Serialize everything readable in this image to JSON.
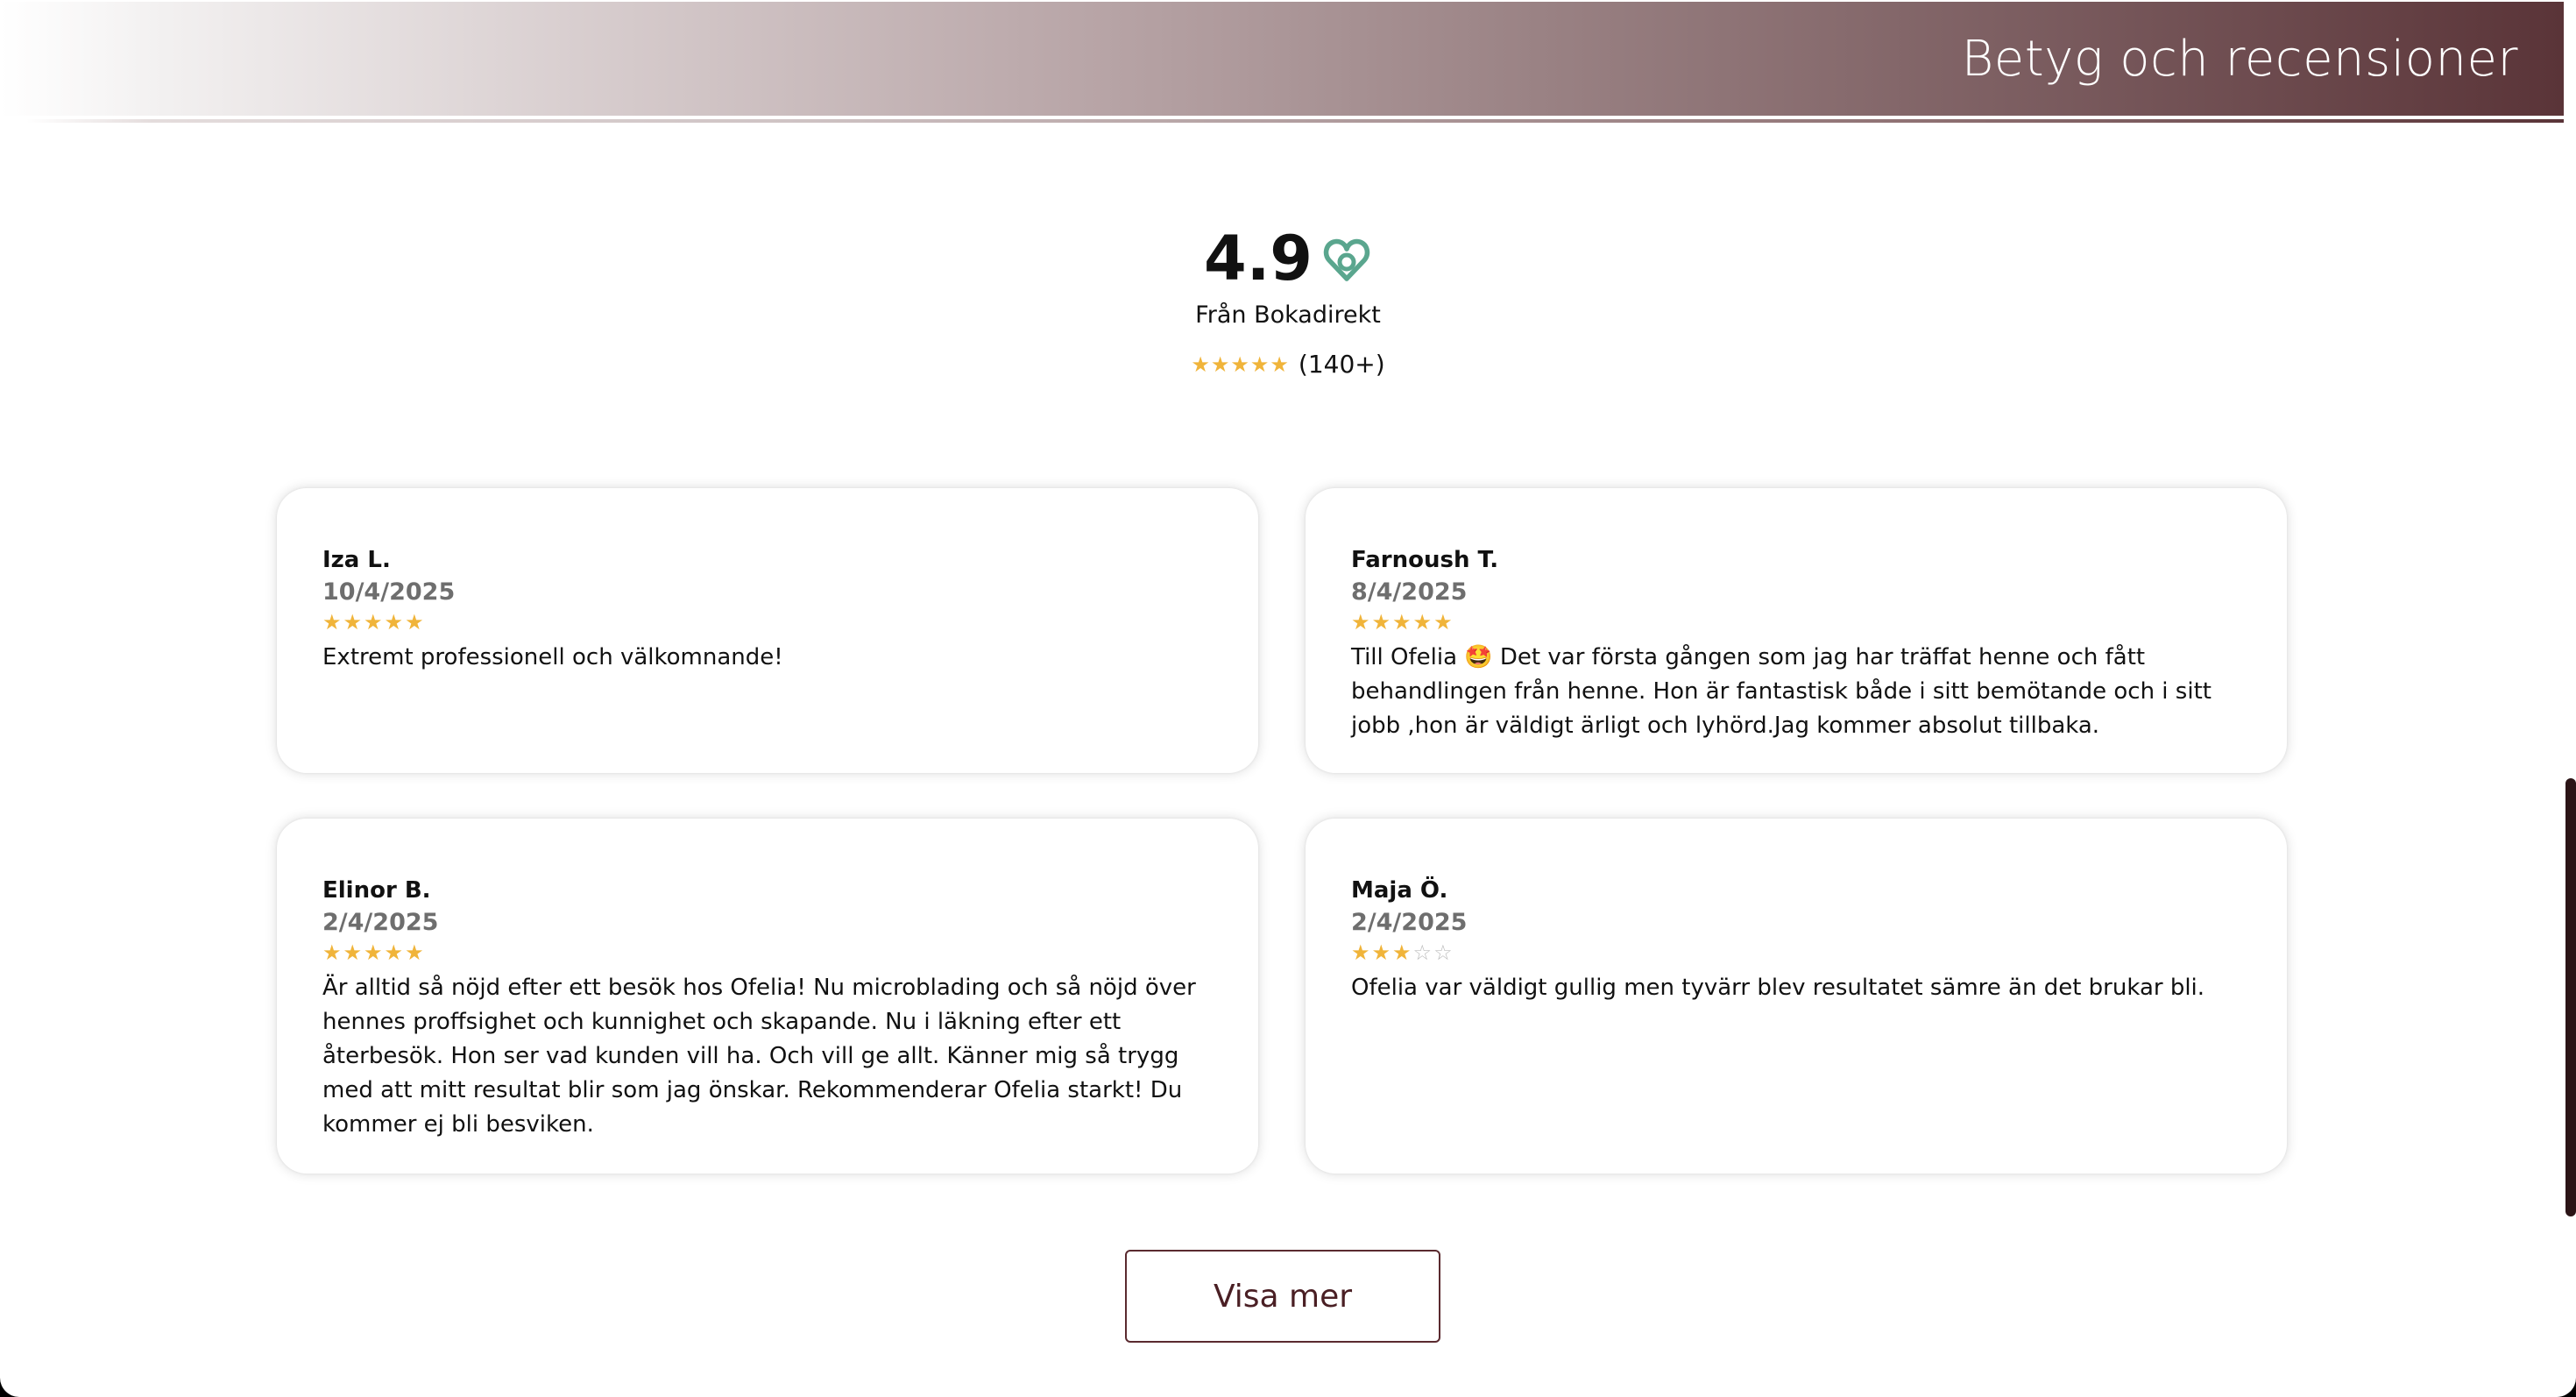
{
  "header": {
    "title": "Betyg och recensioner"
  },
  "summary": {
    "score": "4.9",
    "source": "Från Bokadirekt",
    "stars": "★★★★★",
    "count": "(140+)",
    "logo_icon": "bokadirekt-logo-icon",
    "logo_color": "#5aa68e"
  },
  "reviews": [
    {
      "name": "Iza L.",
      "date": "10/4/2025",
      "rating": 5,
      "stars_filled": "★★★★★",
      "stars_empty": "",
      "text": "Extremt professionell och välkomnande!"
    },
    {
      "name": "Farnoush T.",
      "date": "8/4/2025",
      "rating": 5,
      "stars_filled": "★★★★★",
      "stars_empty": "",
      "text": "Till Ofelia 🤩 Det var första gången som jag har träffat henne och fått behandlingen från henne. Hon är fantastisk både i sitt bemötande och i sitt jobb ,hon är väldigt ärligt och lyhörd.Jag kommer absolut tillbaka."
    },
    {
      "name": "Elinor B.",
      "date": "2/4/2025",
      "rating": 5,
      "stars_filled": "★★★★★",
      "stars_empty": "",
      "text": "Är alltid så nöjd efter ett besök hos Ofelia! Nu microblading och så nöjd över hennes proffsighet och kunnighet och skapande. Nu i läkning efter ett återbesök. Hon ser vad kunden vill ha. Och vill ge allt. Känner mig så trygg med att mitt resultat blir som jag önskar. Rekommenderar Ofelia starkt! Du kommer ej bli besviken."
    },
    {
      "name": "Maja Ö.",
      "date": "2/4/2025",
      "rating": 3,
      "stars_filled": "★★★",
      "stars_empty": "☆☆",
      "text": "Ofelia var väldigt gullig men tyvärr blev resultatet sämre än det brukar bli."
    }
  ],
  "actions": {
    "more_label": "Visa mer"
  },
  "colors": {
    "star": "#f0b43a",
    "brand_dark": "#5a2a2f",
    "header_gradient_end": "#5a3438"
  }
}
